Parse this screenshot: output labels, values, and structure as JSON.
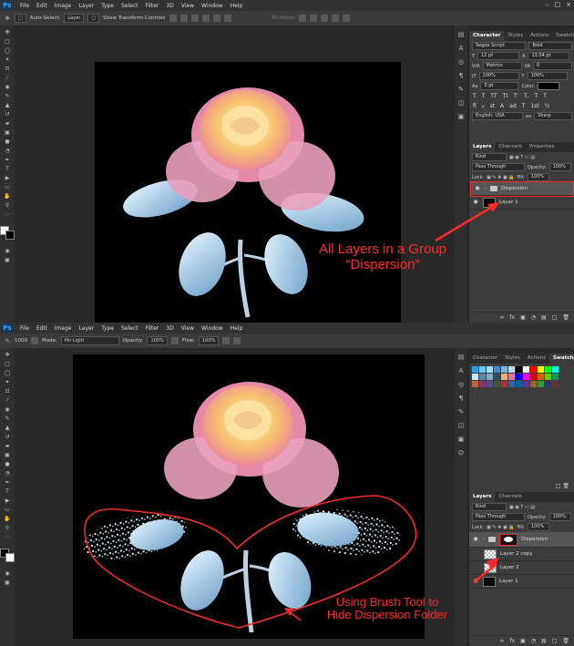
{
  "menu": [
    "File",
    "Edit",
    "Image",
    "Layer",
    "Type",
    "Select",
    "Filter",
    "3D",
    "View",
    "Window",
    "Help"
  ],
  "app_logo": "Ps",
  "top_options": {
    "auto_select_label": "Auto-Select:",
    "auto_select_value": "Layer",
    "show_transform_label": "Show Transform Controls",
    "mode_3d_label": "3D Mode:"
  },
  "bottom_options": {
    "brush_size": "1000",
    "mode_label": "Mode:",
    "mode_value": "Pin Light",
    "opacity_label": "Opacity:",
    "opacity_value": "100%",
    "flow_label": "Flow:",
    "flow_value": "100%"
  },
  "character_panel": {
    "tabs": [
      "Character",
      "Styles",
      "Actions",
      "Swatche"
    ],
    "font_family": "Segoe Script",
    "font_style": "Bold",
    "font_size": "12 pt",
    "leading": "13.04 pt",
    "kerning": "Metrics",
    "tracking": "0",
    "vscale": "100%",
    "hscale": "100%",
    "baseline": "0 pt",
    "color_label": "Color:",
    "type_buttons": [
      "T",
      "T",
      "TT",
      "Tt",
      "T'",
      "T,",
      "T",
      "T"
    ],
    "opentype_buttons": [
      "fi",
      "ℴ",
      "st",
      "A",
      "ad",
      "T",
      "1st",
      "½"
    ],
    "language": "English: USA",
    "antialias": "Sharp"
  },
  "top_layers_panel": {
    "tabs": [
      "Layers",
      "Channels",
      "Properties"
    ],
    "filter_label": "Kind",
    "blend_mode": "Pass Through",
    "opacity_label": "Opacity:",
    "opacity_value": "100%",
    "lock_label": "Lock:",
    "fill_label": "Fill:",
    "fill_value": "100%",
    "layers": [
      {
        "name": "Dispersion",
        "type": "group"
      },
      {
        "name": "Layer 1",
        "type": "layer"
      }
    ]
  },
  "swatches_panel": {
    "tabs": [
      "Character",
      "Styles",
      "Actions",
      "Swatches"
    ]
  },
  "bottom_layers_panel": {
    "tabs": [
      "Layers",
      "Channels"
    ],
    "filter_label": "Kind",
    "blend_mode": "Pass Through",
    "opacity_label": "Opacity:",
    "opacity_value": "100%",
    "lock_label": "Lock:",
    "fill_label": "Fill:",
    "fill_value": "100%",
    "layers": [
      {
        "name": "Dispersion",
        "type": "group"
      },
      {
        "name": "Layer 2 copy",
        "type": "layer"
      },
      {
        "name": "Layer 2",
        "type": "layer"
      },
      {
        "name": "Layer 1",
        "type": "layer"
      }
    ]
  },
  "annotations": {
    "top_line1": "All Layers in a Group",
    "top_line2": "“Dispersion”",
    "bottom_line1": "Using Brush Tool to",
    "bottom_line2": "Hide Dispersion Folder"
  },
  "colors": {
    "annotation_red": "#ff2a2a",
    "canvas_black": "#000000",
    "ui_dark": "#282828"
  }
}
